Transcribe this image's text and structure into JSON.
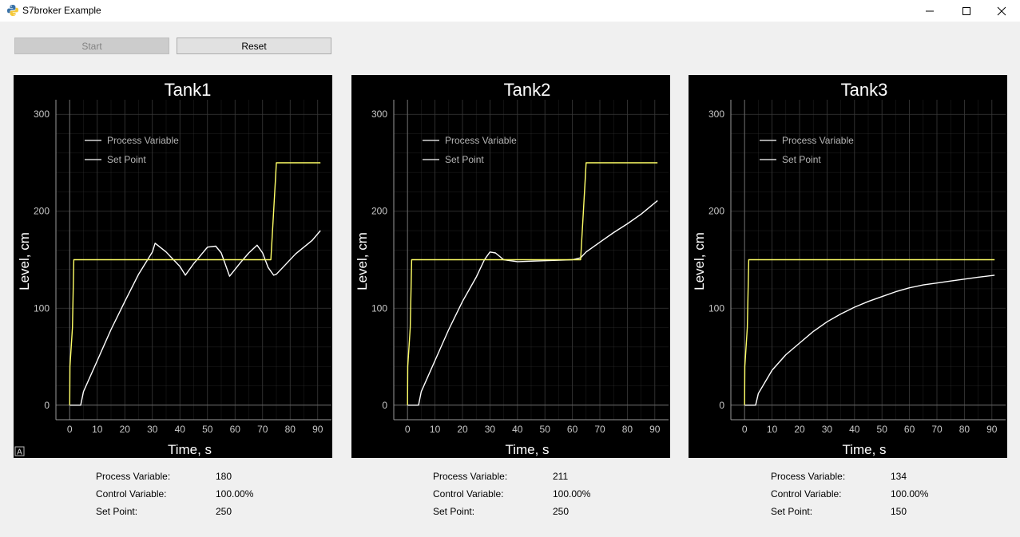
{
  "window": {
    "title": "S7broker Example",
    "icon": "python-icon",
    "controls": [
      "minimize-icon",
      "maximize-icon",
      "close-icon"
    ]
  },
  "toolbar": {
    "start_label": "Start",
    "start_enabled": false,
    "reset_label": "Reset"
  },
  "legend": {
    "pv": "Process Variable",
    "sp": "Set Point"
  },
  "colors": {
    "plot_bg": "#000000",
    "pv_line": "#ffffff",
    "sp_line": "#ffff66",
    "grid": "#3a3a3a",
    "axis_text": "#c8c8c8"
  },
  "labels": {
    "pv": "Process Variable:",
    "cv": "Control Variable:",
    "sp": "Set Point:"
  },
  "tanks": [
    {
      "name": "Tank1",
      "pv": "180",
      "cv": "100.00%",
      "sp": "250"
    },
    {
      "name": "Tank2",
      "pv": "211",
      "cv": "100.00%",
      "sp": "250"
    },
    {
      "name": "Tank3",
      "pv": "134",
      "cv": "100.00%",
      "sp": "150"
    }
  ],
  "chart_data": [
    {
      "type": "line",
      "title": "Tank1",
      "xlabel": "Time, s",
      "ylabel": "Level, cm",
      "xlim": [
        -5,
        95
      ],
      "ylim": [
        -15,
        315
      ],
      "xticks": [
        0,
        10,
        20,
        30,
        40,
        50,
        60,
        70,
        80,
        90
      ],
      "yticks": [
        0,
        100,
        200,
        300
      ],
      "grid": true,
      "legend_position": "top-left",
      "series": [
        {
          "name": "Process Variable",
          "color": "#ffffff",
          "x": [
            0,
            4,
            5,
            10,
            15,
            20,
            25,
            30,
            31,
            35,
            40,
            42,
            45,
            50,
            53,
            55,
            58,
            62,
            65,
            68,
            70,
            72,
            74,
            75,
            78,
            82,
            85,
            88,
            91
          ],
          "y": [
            0,
            0,
            14,
            46,
            78,
            107,
            135,
            158,
            167,
            158,
            143,
            134,
            146,
            163,
            164,
            157,
            133,
            147,
            157,
            165,
            157,
            142,
            134,
            135,
            144,
            156,
            163,
            170,
            180
          ]
        },
        {
          "name": "Set Point",
          "color": "#ffff66",
          "x": [
            0,
            0.1,
            1,
            1.5,
            72,
            73,
            74,
            75,
            91
          ],
          "y": [
            0,
            40,
            80,
            150,
            150,
            150,
            200,
            250,
            250
          ]
        }
      ]
    },
    {
      "type": "line",
      "title": "Tank2",
      "xlabel": "Time, s",
      "ylabel": "Level, cm",
      "xlim": [
        -5,
        95
      ],
      "ylim": [
        -15,
        315
      ],
      "xticks": [
        0,
        10,
        20,
        30,
        40,
        50,
        60,
        70,
        80,
        90
      ],
      "yticks": [
        0,
        100,
        200,
        300
      ],
      "grid": true,
      "legend_position": "top-left",
      "series": [
        {
          "name": "Process Variable",
          "color": "#ffffff",
          "x": [
            0,
            4,
            5,
            10,
            15,
            20,
            25,
            28,
            30,
            32,
            35,
            40,
            50,
            60,
            63,
            65,
            70,
            75,
            80,
            85,
            88,
            91
          ],
          "y": [
            0,
            0,
            14,
            46,
            78,
            107,
            132,
            150,
            158,
            157,
            150,
            148,
            149,
            150,
            152,
            158,
            168,
            178,
            187,
            197,
            204,
            211
          ]
        },
        {
          "name": "Set Point",
          "color": "#ffff66",
          "x": [
            0,
            0.1,
            1,
            1.5,
            62,
            63,
            64,
            65,
            91
          ],
          "y": [
            0,
            40,
            80,
            150,
            150,
            150,
            200,
            250,
            250
          ]
        }
      ]
    },
    {
      "type": "line",
      "title": "Tank3",
      "xlabel": "Time, s",
      "ylabel": "Level, cm",
      "xlim": [
        -5,
        95
      ],
      "ylim": [
        -15,
        315
      ],
      "xticks": [
        0,
        10,
        20,
        30,
        40,
        50,
        60,
        70,
        80,
        90
      ],
      "yticks": [
        0,
        100,
        200,
        300
      ],
      "grid": true,
      "legend_position": "top-left",
      "series": [
        {
          "name": "Process Variable",
          "color": "#ffffff",
          "x": [
            0,
            4,
            5,
            10,
            15,
            20,
            25,
            30,
            35,
            40,
            45,
            50,
            55,
            60,
            65,
            70,
            75,
            80,
            85,
            91
          ],
          "y": [
            0,
            0,
            12,
            36,
            52,
            64,
            76,
            86,
            94,
            101,
            107,
            112,
            117,
            121,
            124,
            126,
            128,
            130,
            132,
            134
          ]
        },
        {
          "name": "Set Point",
          "color": "#ffff66",
          "x": [
            0,
            0.1,
            1,
            1.5,
            91
          ],
          "y": [
            0,
            40,
            80,
            150,
            150
          ]
        }
      ]
    }
  ]
}
